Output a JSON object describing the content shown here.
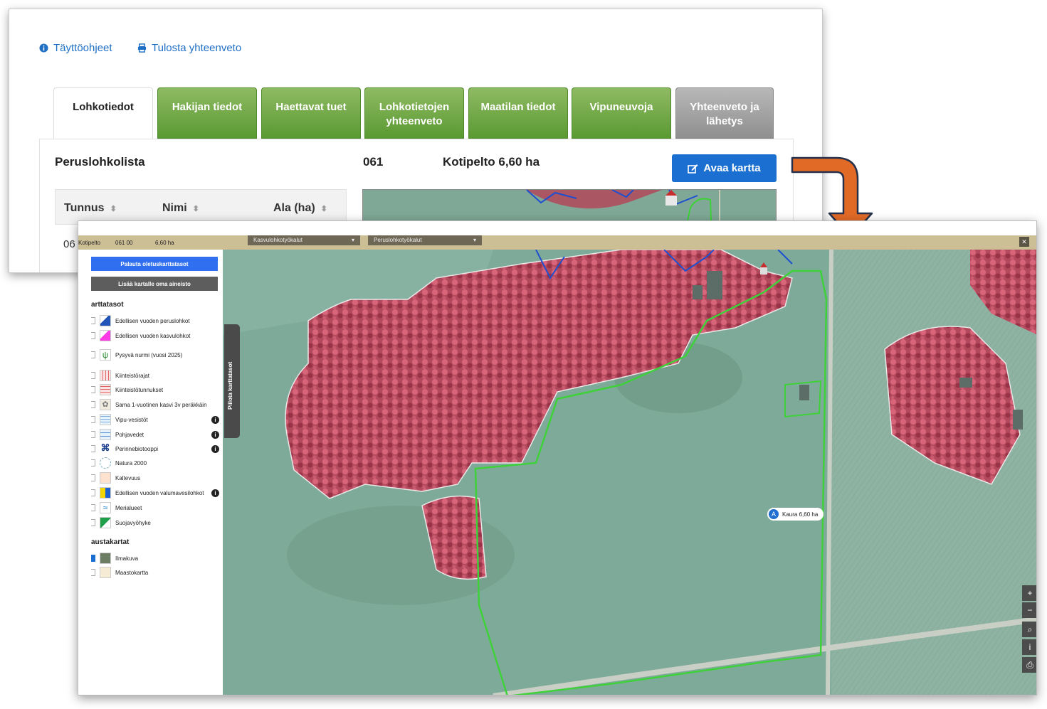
{
  "links": {
    "instructions": "Täyttöohjeet",
    "print_summary": "Tulosta yhteenveto"
  },
  "tabs": [
    {
      "label": "Lohkotiedot",
      "state": "active"
    },
    {
      "label": "Hakijan tiedot",
      "state": "green"
    },
    {
      "label": "Haettavat tuet",
      "state": "green"
    },
    {
      "label": "Lohkotietojen yhteenveto",
      "state": "green"
    },
    {
      "label": "Maatilan tiedot",
      "state": "green"
    },
    {
      "label": "Vipuneuvoja",
      "state": "green"
    },
    {
      "label": "Yhteenveto ja lähetys",
      "state": "gray"
    }
  ],
  "panel": {
    "list_title": "Peruslohkolista",
    "block_id": "061",
    "block_name": "Kotipelto 6,60 ha",
    "open_map_button": "Avaa kartta"
  },
  "table": {
    "headers": [
      "Tunnus",
      "Nimi",
      "Ala (ha)"
    ],
    "partial_row": "06"
  },
  "map_window": {
    "info_name": "Kotipelto",
    "info_id": "061 00",
    "info_area": "6,60 ha",
    "dropdown_1": "Kasvulohkotyökalut",
    "dropdown_2": "Peruslohkotyökalut",
    "btn_restore_layers": "Palauta oletuskarttatasot",
    "btn_add_data": "Lisää kartalle oma aineisto",
    "layers_heading": "arttatasot",
    "layers": [
      {
        "label": "Edellisen vuoden peruslohkot",
        "info": false
      },
      {
        "label": "Edellisen vuoden kasvulohkot",
        "info": false
      },
      {
        "label": "Pysyvä nurmi (vuosi 2025)",
        "info": false
      },
      {
        "label": "Kiinteistörajat",
        "info": false
      },
      {
        "label": "Kiinteistötunnukset",
        "info": false
      },
      {
        "label": "Sama 1-vuotinen kasvi 3v peräkkäin",
        "info": false
      },
      {
        "label": "Vipu-vesistöt",
        "info": true
      },
      {
        "label": "Pohjavedet",
        "info": true
      },
      {
        "label": "Perinnebiotooppi",
        "info": true
      },
      {
        "label": "Natura 2000",
        "info": false
      },
      {
        "label": "Kaltevuus",
        "info": false
      },
      {
        "label": "Edellisen vuoden valumavesilohkot",
        "info": true
      },
      {
        "label": "Merialueet",
        "info": false
      },
      {
        "label": "Suojavyöhyke",
        "info": false
      }
    ],
    "base_heading": "austakartat",
    "base_maps": [
      {
        "label": "Ilmakuva",
        "selected": true
      },
      {
        "label": "Maastokartta",
        "selected": false
      }
    ],
    "hide_layers_label": "Piilota karttatasot",
    "parcel_letter": "A",
    "parcel_label": "Kaura  6,60 ha",
    "zoom_in": "+",
    "zoom_out": "−"
  },
  "colors": {
    "tab_green": "#6aa53c",
    "primary_blue": "#1a6fd1",
    "arrow_orange": "#e26a27",
    "field_green": "#3fd13a"
  }
}
